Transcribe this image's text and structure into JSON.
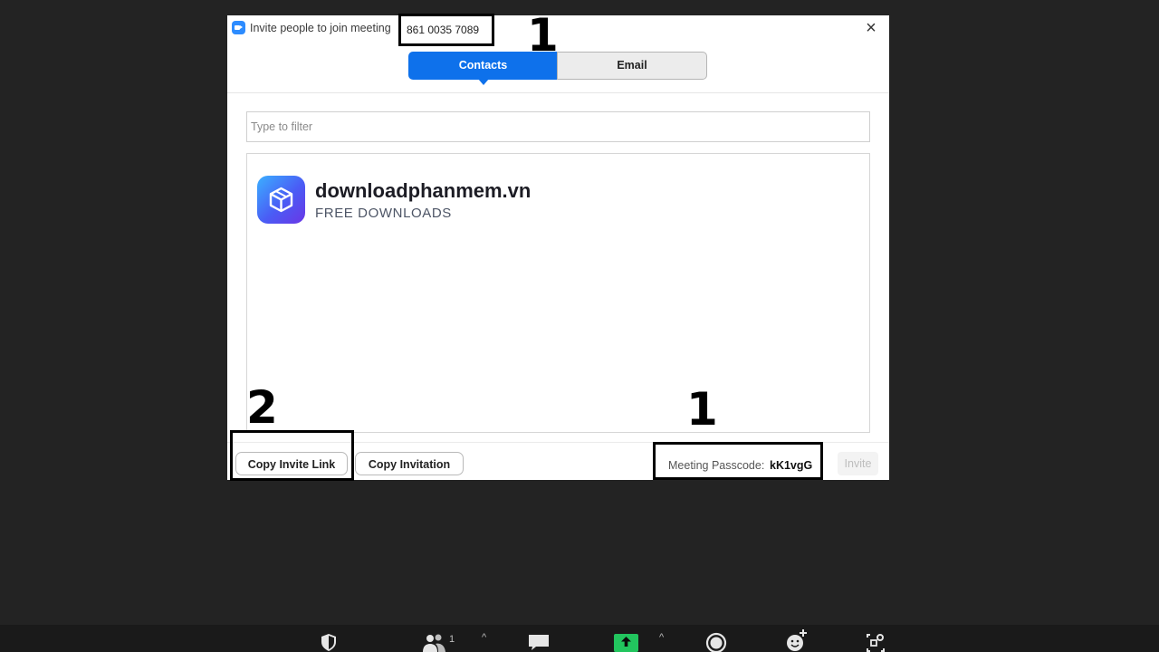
{
  "dialog": {
    "title": "Invite people to join meeting",
    "meeting_id": "861 0035 7089",
    "close_symbol": "×",
    "tabs": [
      {
        "label": "Contacts",
        "active": true
      },
      {
        "label": "Email",
        "active": false
      }
    ],
    "filter_placeholder": "Type to filter",
    "watermark": {
      "title": "downloadphanmem.vn",
      "subtitle": "FREE DOWNLOADS"
    },
    "buttons": {
      "copy_invite_link": "Copy Invite Link",
      "copy_invitation": "Copy Invitation",
      "invite": "Invite"
    },
    "passcode": {
      "label": "Meeting Passcode:",
      "value": "kK1vgG"
    }
  },
  "annotations": {
    "top_number": "1",
    "link_number": "2",
    "passcode_number": "1"
  },
  "toolbar": {
    "items": [
      {
        "icon": "security-shield-icon"
      },
      {
        "icon": "participants-icon",
        "count": "1"
      },
      {
        "icon": "chat-icon"
      },
      {
        "icon": "share-screen-icon"
      },
      {
        "icon": "record-icon"
      },
      {
        "icon": "reactions-icon"
      },
      {
        "icon": "apps-icon"
      }
    ],
    "caret_symbol": "^",
    "share_color": "#22c55e"
  },
  "colors": {
    "accent": "#0e71eb",
    "background": "#232323"
  }
}
